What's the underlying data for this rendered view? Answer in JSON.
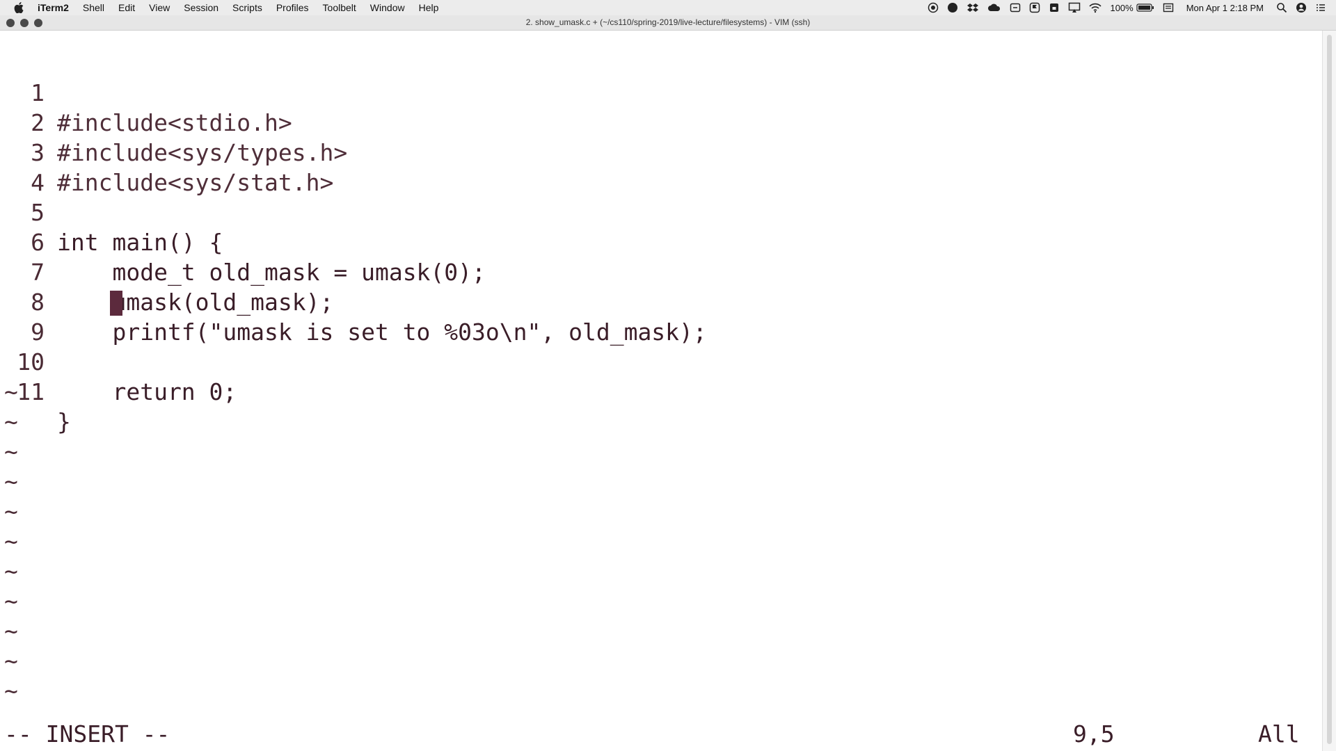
{
  "menubar": {
    "app_name": "iTerm2",
    "items": [
      "Shell",
      "Edit",
      "View",
      "Session",
      "Scripts",
      "Profiles",
      "Toolbelt",
      "Window",
      "Help"
    ],
    "battery": "100%",
    "clock": "Mon Apr 1  2:18 PM",
    "status_icons": [
      "record-icon",
      "circle-icon",
      "dropbox-icon",
      "cloud-icon",
      "box-icon",
      "flag-icon",
      "lock-icon",
      "airplay-icon",
      "wifi-icon",
      "battery-icon",
      "input-icon",
      "search-icon",
      "user-icon",
      "list-icon"
    ]
  },
  "window": {
    "title": "2. show_umask.c + (~/cs110/spring-2019/live-lecture/filesystems) - VIM (ssh)"
  },
  "editor": {
    "lines": [
      {
        "num": "1",
        "text": "#include<stdio.h>"
      },
      {
        "num": "2",
        "text": "#include<sys/types.h>"
      },
      {
        "num": "3",
        "text": "#include<sys/stat.h>"
      },
      {
        "num": "4",
        "text": ""
      },
      {
        "num": "5",
        "text": "int main() {"
      },
      {
        "num": "6",
        "text": "    mode_t old_mask = umask(0);"
      },
      {
        "num": "7",
        "text": "    umask(old_mask);"
      },
      {
        "num": "8",
        "text": "    printf(\"umask is set to %03o\\n\", old_mask);"
      },
      {
        "num": "9",
        "text": ""
      },
      {
        "num": "10",
        "text": "    return 0;"
      },
      {
        "num": "11",
        "text": "}"
      }
    ],
    "tilde": "~",
    "mode": "-- INSERT --",
    "cursor_position": "9,5",
    "scroll_indicator": "All"
  },
  "colors": {
    "text": "#3a1d28",
    "cursor": "#5c2a3d",
    "muted": "#8a7479",
    "background": "#ffffff"
  }
}
